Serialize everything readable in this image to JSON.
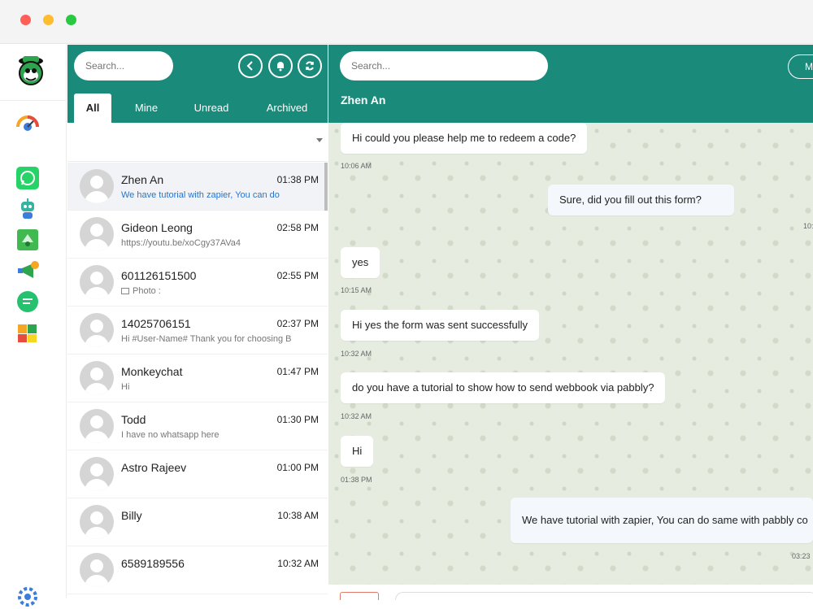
{
  "app": {
    "brand_colors": {
      "header": "#1a8a7a",
      "chat_background": "#e6ede0",
      "link_blue": "#2a74c9"
    }
  },
  "sidebar": {
    "icons": [
      "monkey-logo-icon",
      "dashboard-gauge-icon",
      "whatsapp-icon",
      "robot-icon",
      "broadcast-icon",
      "campaign-icon",
      "chat-bubble-icon",
      "puzzle-icon",
      "settings-icon"
    ]
  },
  "chat_list": {
    "search_placeholder": "Search...",
    "tabs": [
      {
        "label": "All",
        "active": true
      },
      {
        "label": "Mine",
        "active": false
      },
      {
        "label": "Unread",
        "active": false
      },
      {
        "label": "Archived",
        "active": false
      }
    ],
    "conversations": [
      {
        "name": "Zhen An",
        "time": "01:38 PM",
        "preview": "We have tutorial with zapier, You can do",
        "selected": true
      },
      {
        "name": "Gideon Leong",
        "time": "02:58 PM",
        "preview": "https://youtu.be/xoCgy37AVa4"
      },
      {
        "name": "601126151500",
        "time": "02:55 PM",
        "preview": "Photo :"
      },
      {
        "name": "14025706151",
        "time": "02:37 PM",
        "preview": "Hi #User-Name# Thank you for choosing B"
      },
      {
        "name": "Monkeychat",
        "time": "01:47 PM",
        "preview": "Hi"
      },
      {
        "name": "Todd",
        "time": "01:30 PM",
        "preview": "I have no whatsapp here"
      },
      {
        "name": "Astro Rajeev",
        "time": "01:00 PM",
        "preview": ""
      },
      {
        "name": "Billy",
        "time": "10:38 AM",
        "preview": ""
      },
      {
        "name": "6589189556",
        "time": "10:32 AM",
        "preview": ""
      }
    ]
  },
  "chat": {
    "search_placeholder": "Search...",
    "contact_name": "Zhen An",
    "header_button_label": "M",
    "messages": [
      {
        "text": "Hi could you please help me to redeem a code?",
        "time": "10:06 AM",
        "direction": "in"
      },
      {
        "text": "Sure, did you fill out this form?",
        "time": "10:",
        "direction": "out"
      },
      {
        "text": "yes",
        "time": "10:15 AM",
        "direction": "in"
      },
      {
        "text": "Hi yes the form was sent successfully",
        "time": "10:32 AM",
        "direction": "in"
      },
      {
        "text": "do you have a tutorial to show how to send webbook via pabbly?",
        "time": "10:32 AM",
        "direction": "in"
      },
      {
        "text": "Hi",
        "time": "01:38 PM",
        "direction": "in"
      },
      {
        "text": "We have tutorial with zapier, You can do same with pabbly co",
        "time": "03:23",
        "direction": "out"
      }
    ]
  }
}
